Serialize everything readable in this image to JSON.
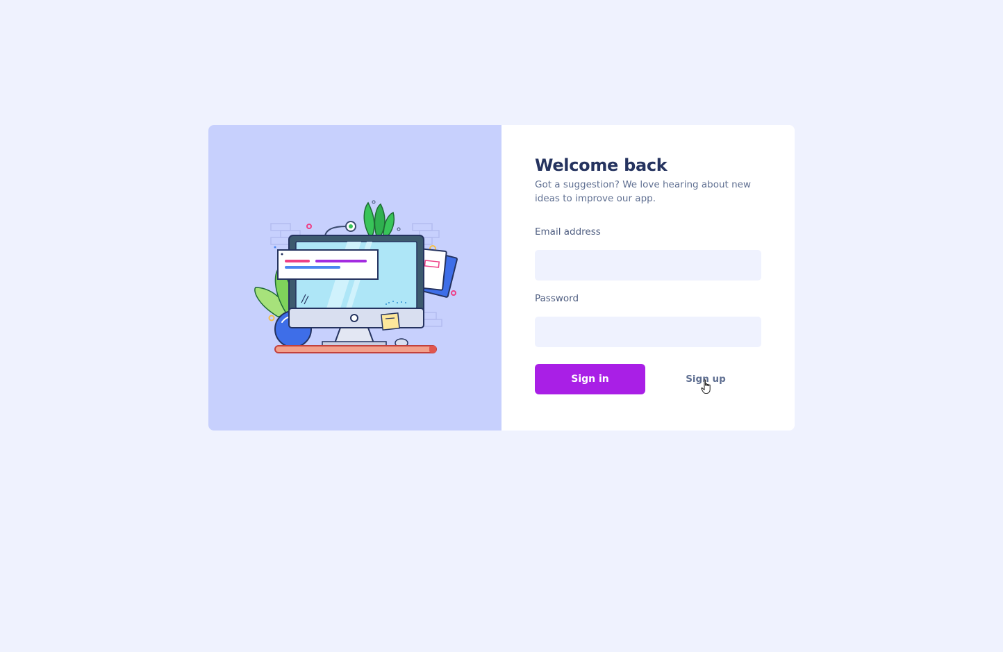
{
  "login": {
    "title": "Welcome back",
    "subtitle": "Got a suggestion? We love hearing about new ideas to improve our app.",
    "email": {
      "label": "Email address",
      "value": "",
      "placeholder": ""
    },
    "password": {
      "label": "Password",
      "value": "",
      "placeholder": ""
    },
    "signin_label": "Sign in",
    "signup_label": "Sign up"
  },
  "illustration": {
    "icon": "desktop-computer-illustration"
  },
  "colors": {
    "page_background": "#eff2fe",
    "illustration_panel": "#c7d0fd",
    "primary_button": "#a91fe6",
    "heading_text": "#25335f",
    "body_text": "#5f6f91",
    "input_background": "#eff2fe"
  }
}
